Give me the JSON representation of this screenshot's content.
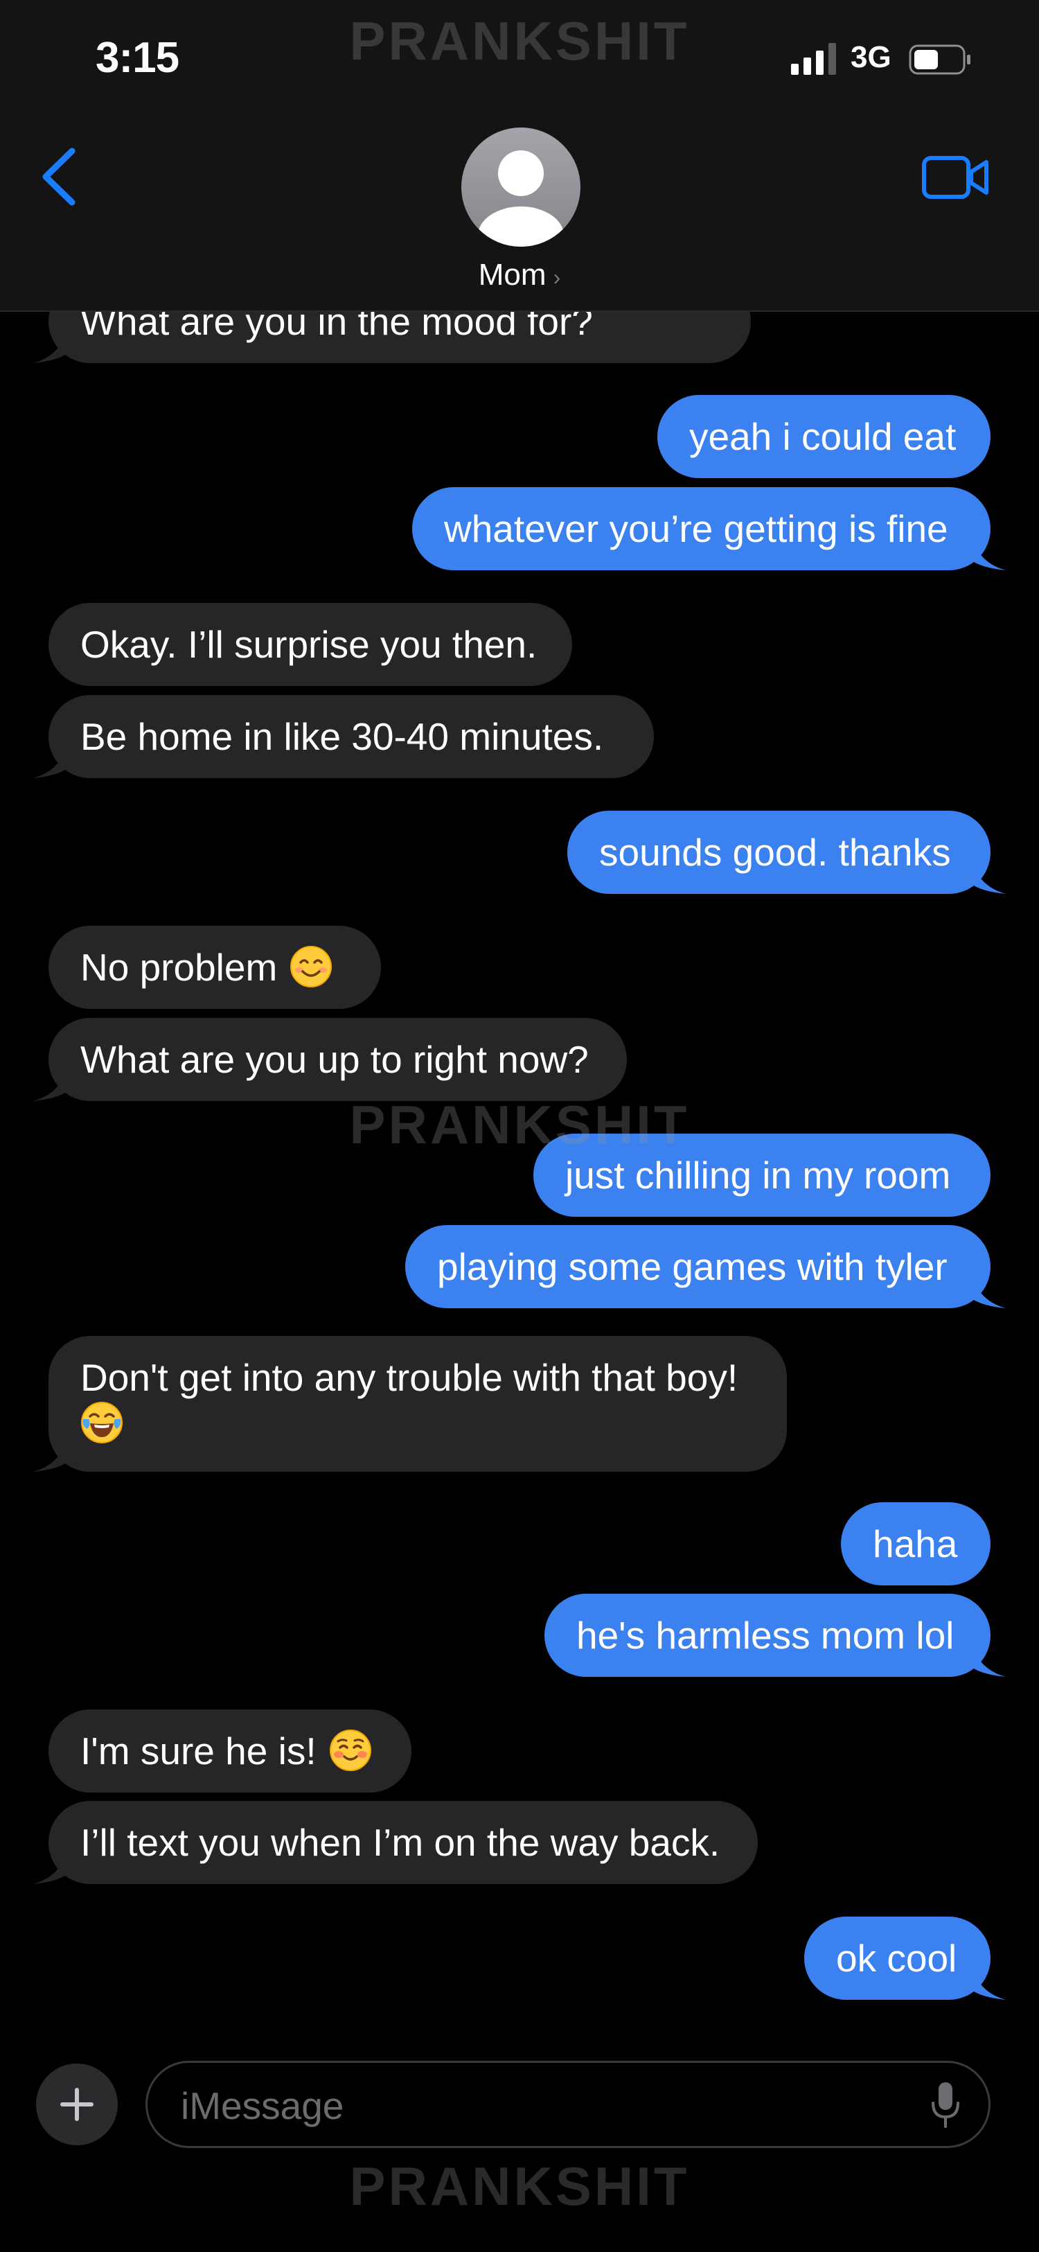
{
  "status_bar": {
    "time": "3:15",
    "network": "3G"
  },
  "watermark": "PRANKSHIT",
  "header": {
    "contact_name": "Mom",
    "chevron": "›",
    "icons": {
      "back": "chevron-left-icon",
      "avatar": "person-icon",
      "video": "video-camera-icon"
    }
  },
  "colors": {
    "sent_bubble": "#3b82f0",
    "received_bubble": "#262629",
    "accent": "#1a7cff",
    "background": "#000000"
  },
  "messages": [
    {
      "from": "mom",
      "text": "What are you in the mood for?"
    },
    {
      "from": "me",
      "text": "yeah i could eat"
    },
    {
      "from": "me",
      "text": "whatever you’re getting is fine"
    },
    {
      "from": "mom",
      "text": "Okay. I’ll surprise you then."
    },
    {
      "from": "mom",
      "text": "Be home in like 30-40 minutes."
    },
    {
      "from": "me",
      "text": "sounds good. thanks"
    },
    {
      "from": "mom",
      "text": "No problem",
      "emoji": "smiling-face-with-smiling-eyes"
    },
    {
      "from": "mom",
      "text": "What are you up to right now?"
    },
    {
      "from": "me",
      "text": "just chilling in my room"
    },
    {
      "from": "me",
      "text": "playing some games with tyler"
    },
    {
      "from": "mom",
      "text": "Don't get into any trouble with that boy!",
      "emoji": "face-with-tears-of-joy"
    },
    {
      "from": "me",
      "text": "haha"
    },
    {
      "from": "me",
      "text": "he's harmless mom lol"
    },
    {
      "from": "mom",
      "text": "I'm sure he is!",
      "emoji": "smiling-face-with-blush"
    },
    {
      "from": "mom",
      "text": "I’ll text you when I’m on the way back."
    },
    {
      "from": "me",
      "text": "ok cool"
    }
  ],
  "input": {
    "placeholder": "iMessage",
    "icons": {
      "add": "plus-icon",
      "mic": "microphone-icon"
    }
  }
}
